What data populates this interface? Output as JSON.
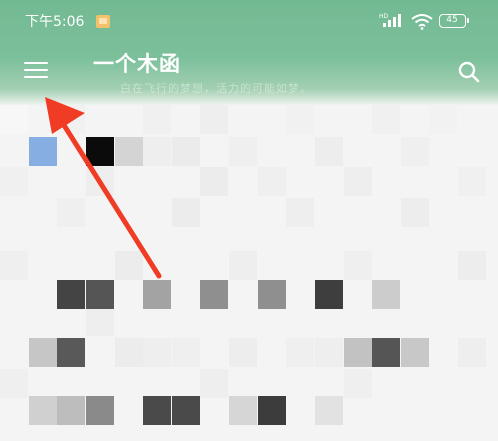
{
  "status_bar": {
    "time": "下午5:06",
    "battery_level": "45",
    "notification_icon": "app-notification-icon",
    "signal_icon": "cellular-signal-icon",
    "wifi_icon": "wifi-icon",
    "battery_icon": "battery-icon"
  },
  "app_bar": {
    "title": "一个木函",
    "subtitle": "白在飞行的梦想，活力的可能如梦。",
    "menu_icon": "hamburger-menu-icon",
    "search_icon": "search-icon"
  },
  "annotation": {
    "type": "red-arrow",
    "points_to": "menu-button",
    "color": "#f03c25"
  },
  "colors": {
    "app_bar": "#76bc96",
    "page_background": "#f4f4f4",
    "accent_tile": "#86aee2"
  }
}
